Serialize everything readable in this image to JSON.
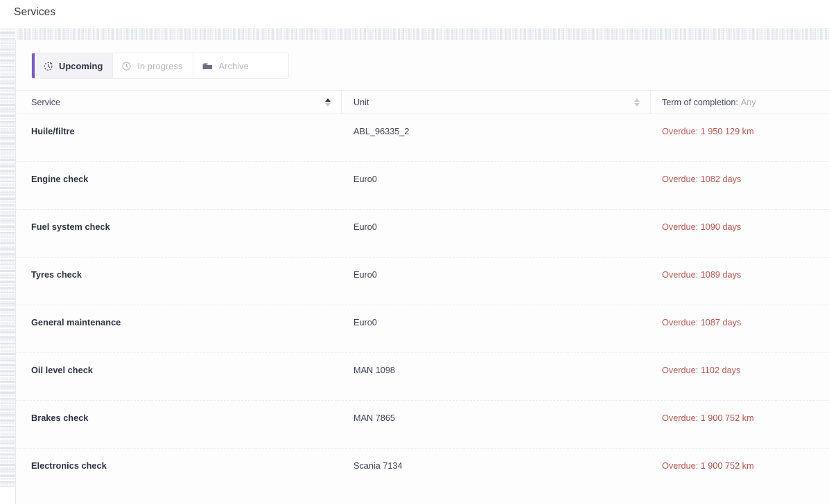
{
  "page": {
    "title": "Services"
  },
  "tabs": [
    {
      "id": "upcoming",
      "label": "Upcoming",
      "icon": "timer-clock-icon",
      "active": true
    },
    {
      "id": "in-progress",
      "label": "In progress",
      "icon": "clock-icon",
      "active": false
    },
    {
      "id": "archive",
      "label": "Archive",
      "icon": "folder-icon",
      "active": false
    }
  ],
  "table": {
    "columns": [
      {
        "key": "service",
        "label": "Service",
        "sortable": true,
        "sort": "asc"
      },
      {
        "key": "unit",
        "label": "Unit",
        "sortable": true,
        "sort": "none"
      },
      {
        "key": "term",
        "label": "Term of completion:",
        "filter_value": "Any",
        "sortable": false
      }
    ],
    "rows": [
      {
        "service": "Huile/filtre",
        "unit": "ABL_96335_2",
        "term": "Overdue: 1 950 129 km"
      },
      {
        "service": "Engine check",
        "unit": "Euro0",
        "term": "Overdue: 1082 days"
      },
      {
        "service": "Fuel system check",
        "unit": "Euro0",
        "term": "Overdue: 1090 days"
      },
      {
        "service": "Tyres check",
        "unit": "Euro0",
        "term": "Overdue: 1089 days"
      },
      {
        "service": "General maintenance",
        "unit": "Euro0",
        "term": "Overdue: 1087 days"
      },
      {
        "service": "Oil level check",
        "unit": "MAN 1098",
        "term": "Overdue: 1102 days"
      },
      {
        "service": "Brakes check",
        "unit": "MAN 7865",
        "term": "Overdue: 1 900 752 km"
      },
      {
        "service": "Electronics check",
        "unit": "Scania 7134",
        "term": "Overdue: 1 900 752 km"
      }
    ]
  },
  "colors": {
    "accent_purple": "#7a5bc4",
    "overdue_red": "#b5564e",
    "text_dark": "#2d3142",
    "text_muted": "#b7b9c3"
  }
}
